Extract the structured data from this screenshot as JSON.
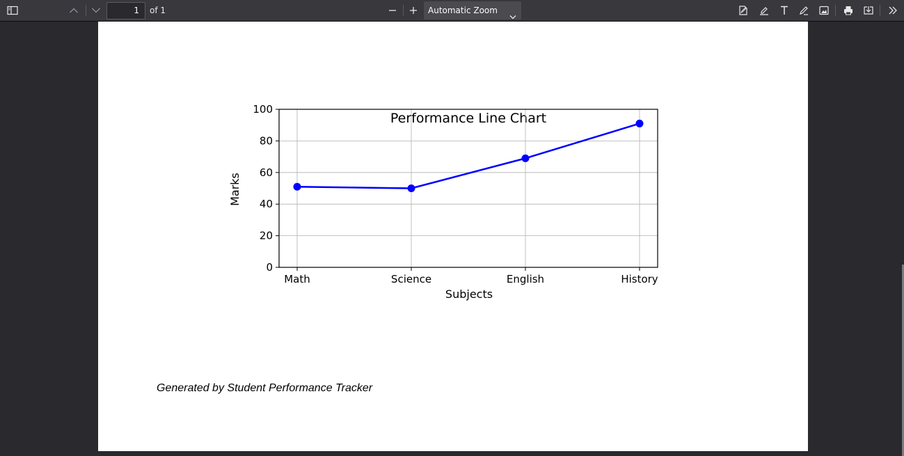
{
  "toolbar": {
    "page_number": "1",
    "page_count_label": "of 1",
    "zoom_label": "Automatic Zoom"
  },
  "document": {
    "footer_text": "Generated by Student Performance Tracker"
  },
  "chart_data": {
    "type": "line",
    "title": "Performance Line Chart",
    "xlabel": "Subjects",
    "ylabel": "Marks",
    "categories": [
      "Math",
      "Science",
      "English",
      "History"
    ],
    "series": [
      {
        "values": [
          51,
          50,
          69,
          91
        ],
        "color": "#0000ff",
        "marker": "circle"
      }
    ],
    "ylim": [
      0,
      100
    ],
    "yticks": [
      0,
      20,
      40,
      60,
      80,
      100
    ],
    "grid": true
  }
}
